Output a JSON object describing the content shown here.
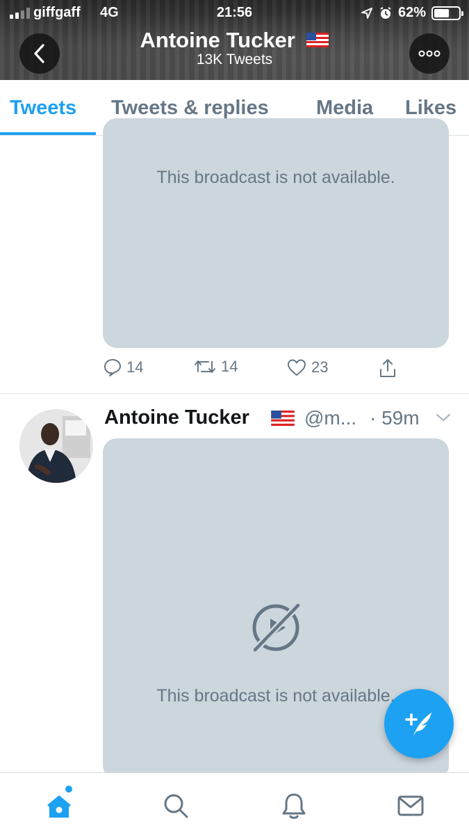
{
  "status_bar": {
    "carrier": "giffgaff",
    "network": "4G",
    "time": "21:56",
    "battery_percent": "62%",
    "battery_level": 0.62,
    "signal_bars_filled": 2,
    "signal_bars_total": 4
  },
  "header": {
    "name": "Antoine Tucker",
    "tweet_count": "13K Tweets",
    "flag_icon": "us-flag-icon"
  },
  "tabs": [
    {
      "label": "Tweets",
      "active": true
    },
    {
      "label": "Tweets & replies",
      "active": false
    },
    {
      "label": "Media",
      "active": false
    },
    {
      "label": "Likes",
      "active": false
    }
  ],
  "tweet_1": {
    "broadcast_text": "This broadcast is not available.",
    "actions": {
      "replies": "14",
      "retweets": "14",
      "likes": "23"
    }
  },
  "tweet_2": {
    "name": "Antoine Tucker",
    "handle": "@m...",
    "time": "· 59m",
    "broadcast_text": "This broadcast is not available."
  },
  "colors": {
    "accent": "#1da1f2",
    "muted": "#657786",
    "media_bg": "#ccd6dd"
  },
  "icons": {
    "nav": [
      "home-icon",
      "search-icon",
      "notifications-icon",
      "messages-icon"
    ],
    "fab": "compose-tweet-icon"
  }
}
